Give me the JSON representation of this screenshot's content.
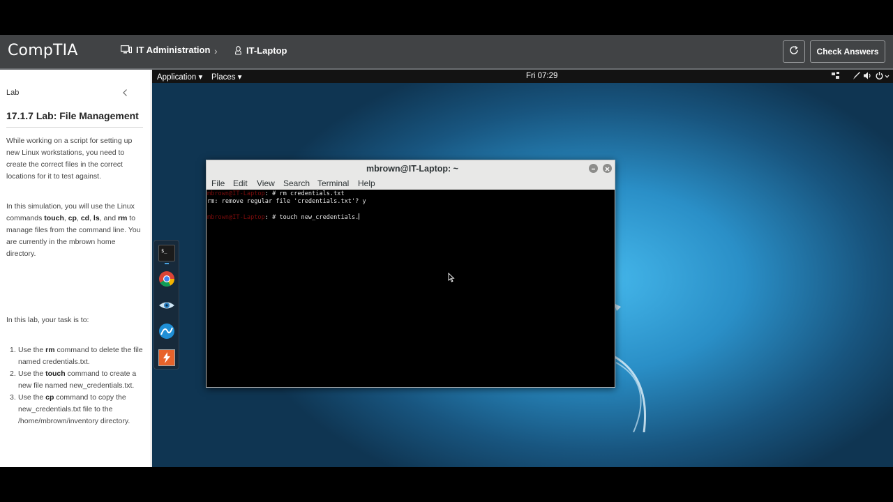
{
  "header": {
    "logo": "CompTIA",
    "breadcrumb": [
      {
        "label": "IT Administration",
        "icon": "monitor-icon"
      },
      {
        "label": "IT-Laptop",
        "icon": "linux-penguin-icon"
      }
    ],
    "separator": "›",
    "reset_icon": "refresh-icon",
    "check_answers": "Check Answers"
  },
  "sidebar": {
    "section_label": "Lab",
    "collapse_icon": "chevron-left-icon",
    "title": "17.1.7 Lab: File Management",
    "intro": "While working on a script for setting up new Linux workstations, you need to create the correct files in the correct locations for it to test against.",
    "commands_intro": {
      "prefix": "In this simulation, you will use the Linux commands ",
      "cmd1": "touch",
      "sep1": ", ",
      "cmd2": "cp",
      "sep2": ", ",
      "cmd3": "cd",
      "sep3": ", ",
      "cmd4": "ls",
      "sep4": ", and ",
      "cmd5": "rm",
      "suffix": " to manage files from the command line. You are currently in the mbrown home directory."
    },
    "task_lead": "In this lab, your task is to:",
    "tasks": [
      {
        "num": "1.",
        "pre": "Use the ",
        "cmd": "rm",
        "post": " command to delete the file named credentials.txt."
      },
      {
        "num": "2.",
        "pre": "Use the ",
        "cmd": "touch",
        "post": " command to create a new file named new_credentials.txt."
      },
      {
        "num": "3.",
        "pre": "Use the ",
        "cmd": "cp",
        "post": " command to copy the new_credentials.txt file to the /home/mbrown/inventory directory."
      }
    ]
  },
  "desktop": {
    "panel": {
      "application": "Application ▾",
      "places": "Places ▾",
      "clock": "Fri 07:29"
    },
    "dock_items": [
      "terminal-icon",
      "chrome-icon",
      "eye-icon",
      "wireshark-fin-icon",
      "burp-icon"
    ],
    "terminal": {
      "title": "mbrown@IT-Laptop: ~",
      "menu": [
        "File",
        "Edit",
        "View",
        "Search",
        "Terminal",
        "Help"
      ],
      "prompt": "mbrown@IT-Laptop",
      "lines": [
        {
          "prompt": true,
          "text": ": # rm credentials.txt"
        },
        {
          "prompt": false,
          "text": "rm: remove regular file 'credentials.txt'? y"
        },
        {
          "prompt": false,
          "text": ""
        },
        {
          "prompt": true,
          "text": ": # touch new_credentials."
        }
      ]
    }
  },
  "colors": {
    "header_bg": "#414345",
    "terminal_bg": "#000000",
    "prompt": "#7a0c0c",
    "desktop_accent": "#2a8fc7"
  }
}
